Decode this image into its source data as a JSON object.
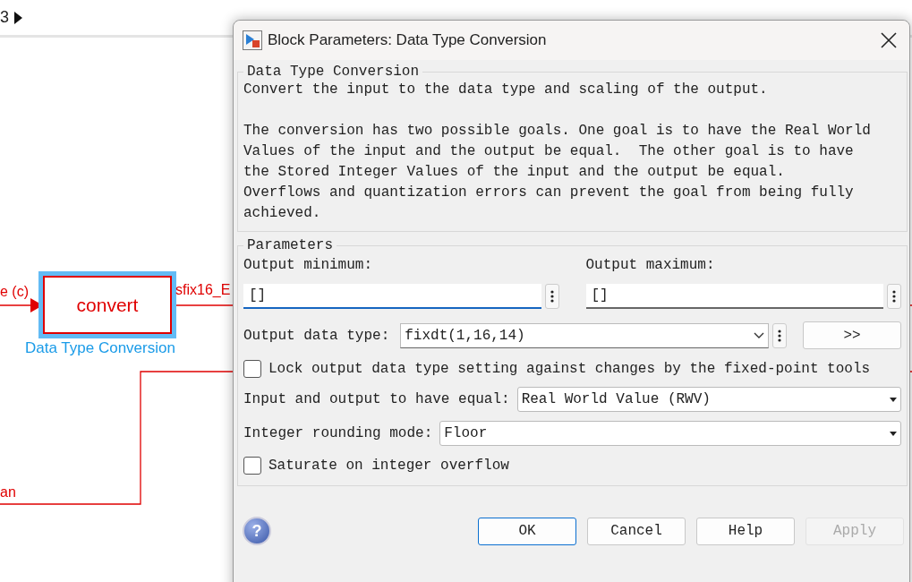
{
  "breadcrumb": {
    "label": "3"
  },
  "diagram": {
    "input_signal": "e (c)",
    "block": {
      "text": "convert",
      "name": "Data Type Conversion",
      "selected": true
    },
    "output_signal": "sfix16_E",
    "feedback_signal": "an"
  },
  "dialog": {
    "title": "Block Parameters: Data Type Conversion",
    "description": {
      "heading": "Data Type Conversion",
      "paragraphs": [
        "Convert the input to the data type and scaling of the output.",
        "The conversion has two possible goals. One goal is to have the Real World\nValues of the input and the output be equal.  The other goal is to have\nthe Stored Integer Values of the input and the output be equal.\nOverflows and quantization errors can prevent the goal from being fully\nachieved."
      ]
    },
    "parameters": {
      "heading": "Parameters",
      "output_minimum": {
        "label": "Output minimum:",
        "value": "[]",
        "focused": true
      },
      "output_maximum": {
        "label": "Output maximum:",
        "value": "[]",
        "focused": false
      },
      "output_data_type": {
        "label": "Output data type:",
        "value": "fixdt(1,16,14)",
        "assistant_button": ">>"
      },
      "lock_output": {
        "label": "Lock output data type setting against changes by the fixed-point tools",
        "checked": false
      },
      "equal_mode": {
        "label": "Input and output to have equal:",
        "value": "Real World Value (RWV)"
      },
      "rounding_mode": {
        "label": "Integer rounding mode:",
        "value": "Floor"
      },
      "saturate": {
        "label": "Saturate on integer overflow",
        "checked": false
      }
    },
    "help_icon": "?",
    "buttons": [
      {
        "label": "OK",
        "focused": true,
        "disabled": false
      },
      {
        "label": "Cancel",
        "focused": false,
        "disabled": false
      },
      {
        "label": "Help",
        "focused": false,
        "disabled": false
      },
      {
        "label": "Apply",
        "focused": false,
        "disabled": true
      }
    ]
  }
}
